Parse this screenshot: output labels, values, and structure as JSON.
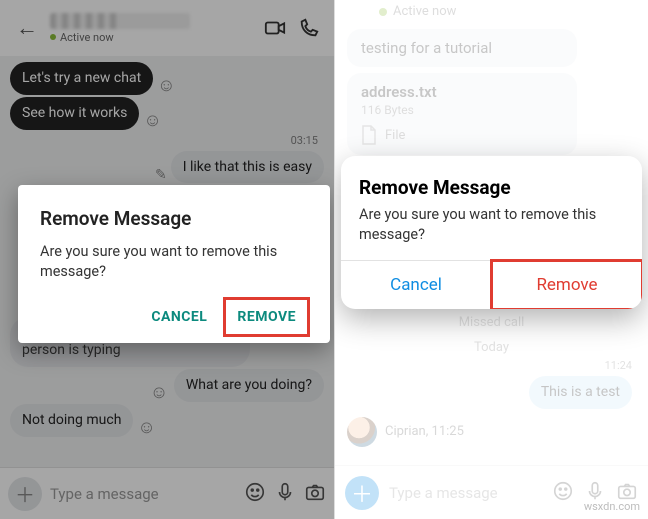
{
  "left": {
    "header": {
      "active_label": "Active now"
    },
    "messages": {
      "recv1": "Let's try a new chat",
      "recv2": "See how it works",
      "ts1": "03:15",
      "sent1": "I like that this is easy",
      "tail": "And it shows when the other person is typing",
      "sent2": "What are you doing?",
      "recv3": "Not doing much"
    },
    "dialog": {
      "title": "Remove Message",
      "body": "Are you sure you want to remove this message?",
      "cancel": "CANCEL",
      "remove": "REMOVE"
    },
    "composer": {
      "placeholder": "Type a message"
    }
  },
  "right": {
    "header": {
      "active_label": "Active now"
    },
    "messages": {
      "card1": "testing for a tutorial",
      "file_name": "address.txt",
      "file_size": "116 Bytes",
      "file_hint": "File",
      "missed": "Missed call",
      "date": "Today",
      "ts1": "11:24",
      "sent1": "This is a test",
      "sender": "Ciprian, 11:25"
    },
    "dialog": {
      "title": "Remove Message",
      "body": "Are you sure you want to remove this message?",
      "cancel": "Cancel",
      "remove": "Remove"
    },
    "composer": {
      "placeholder": "Type a message"
    },
    "watermark": "wsxdn.com"
  }
}
